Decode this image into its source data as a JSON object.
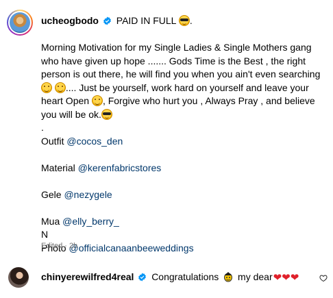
{
  "post": {
    "username": "ucheogbodo",
    "headline": "PAID IN FULL",
    "caption": {
      "p1_a": "Morning Motivation for my Single Ladies & Single Mothers gang who have given up hope ....... Gods Time is the Best , the right person is out there, he will find you when you ain't even searching ",
      "p1_b": ".... Just be yourself, work hard on yourself and leave your heart Open ",
      "p1_c": ", Forgive who hurt you , Always Pray , and believe you will be ok.",
      "dot": ".",
      "outfit_label": "Outfit ",
      "outfit_mention": "@cocos_den",
      "material_label": "Material ",
      "material_mention": "@kerenfabricstores",
      "gele_label": "Gele ",
      "gele_mention": "@nezygele",
      "mua_label": "Mua ",
      "mua_mention": "@elly_berry_",
      "n_line": "N",
      "photo_label": "Photo ",
      "photo_mention": "@officialcanaanbeeweddings"
    },
    "meta": "Edited · 2h"
  },
  "comment": {
    "username": "chinyerewilfred4real",
    "text_a": "Congratulations",
    "text_b": "my dear",
    "hearts": "❤❤❤"
  },
  "icons": {
    "verified": "verified-badge-icon",
    "like": "heart-outline-icon"
  },
  "colors": {
    "mention": "#00376b",
    "meta": "#737373",
    "verified": "#0095f6",
    "heart": "#e0202a"
  }
}
